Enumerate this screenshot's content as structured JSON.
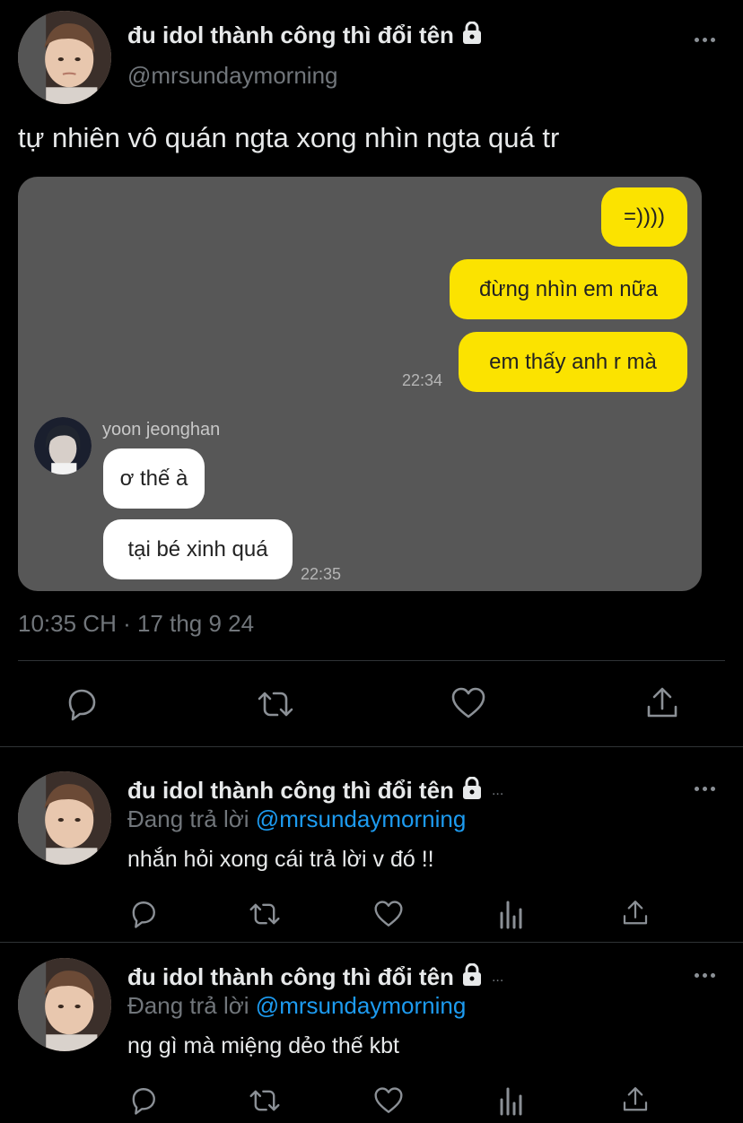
{
  "colors": {
    "background": "#000000",
    "text": "#e7e9ea",
    "muted": "#71767b",
    "mention": "#1d9bf0",
    "chat_bg": "#575757",
    "bubble_yellow": "#fbe300",
    "bubble_white": "#ffffff"
  },
  "main_tweet": {
    "display_name": "đu idol thành công thì đổi tên",
    "handle": "@mrsundaymorning",
    "text": "tự nhiên vô quán ngta xong nhìn ngta quá tr",
    "timestamp": "10:35 CH · 17 thg 9 24",
    "icons": {
      "reply": "reply-icon",
      "retweet": "retweet-icon",
      "like": "like-icon",
      "share": "share-icon",
      "lock": "lock-icon",
      "more": "more-icon"
    }
  },
  "chat": {
    "outgoing": [
      "=))))",
      "đừng nhìn em nữa",
      "em thấy anh r mà"
    ],
    "outgoing_time": "22:34",
    "sender_name": "yoon jeonghan",
    "incoming": [
      "ơ thế à",
      "tại bé xinh quá"
    ],
    "incoming_time": "22:35"
  },
  "replies": [
    {
      "display_name": "đu idol thành công thì đổi tên",
      "ellipsis": "...",
      "replying_prefix": "Đang trả lời",
      "replying_to": "@mrsundaymorning",
      "text": "nhắn hỏi xong cái trả lời v đó !!"
    },
    {
      "display_name": "đu idol thành công thì đổi tên",
      "ellipsis": "...",
      "replying_prefix": "Đang trả lời",
      "replying_to": "@mrsundaymorning",
      "text": "ng gì mà miệng dẻo thế kbt"
    }
  ]
}
